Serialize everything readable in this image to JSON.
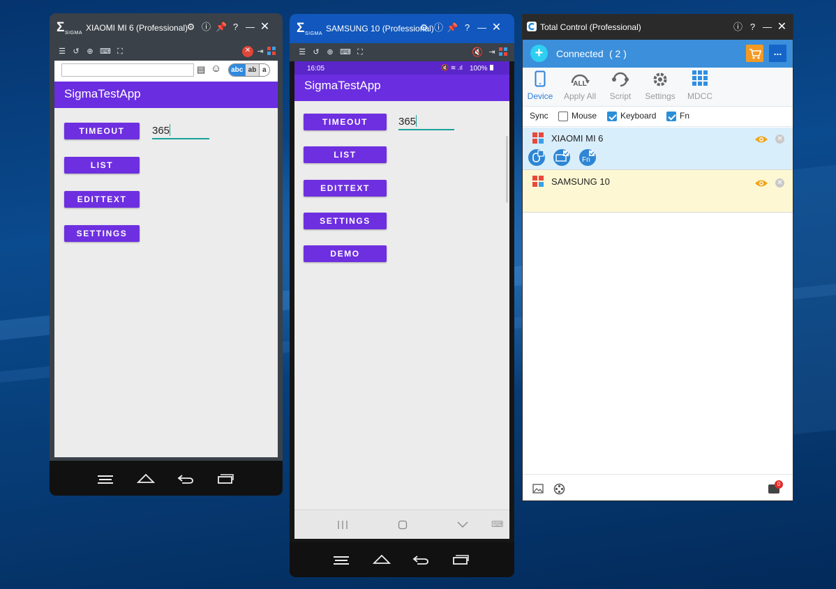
{
  "windows": {
    "xiaomi": {
      "title": "XIAOMI MI 6 (Professional)",
      "logo_text": "SIGMA",
      "app_title": "SigmaTestApp",
      "ime_buttons": [
        "abc",
        "ab",
        "a"
      ],
      "buttons": [
        "TIMEOUT",
        "LIST",
        "EDITTEXT",
        "SETTINGS"
      ],
      "field_value": "365"
    },
    "samsung": {
      "title": "SAMSUNG 10 (Professional)",
      "logo_text": "SIGMA",
      "status_time": "16:05",
      "status_battery": "100%",
      "app_title": "SigmaTestApp",
      "buttons": [
        "TIMEOUT",
        "LIST",
        "EDITTEXT",
        "SETTINGS",
        "DEMO"
      ],
      "field_value": "365"
    }
  },
  "total_control": {
    "title": "Total Control (Professional)",
    "connected_label": "Connected",
    "connected_count": "( 2 )",
    "more_label": "...",
    "tabs": [
      "Device",
      "Apply All",
      "Script",
      "Settings",
      "MDCC"
    ],
    "apply_all_badge": "ALL",
    "sync": {
      "label": "Sync",
      "mouse": "Mouse",
      "keyboard": "Keyboard",
      "fn": "Fn"
    },
    "sync_state": {
      "mouse": false,
      "keyboard": true,
      "fn": true
    },
    "devices": [
      {
        "name": "XIAOMI MI 6"
      },
      {
        "name": "SAMSUNG 10"
      }
    ],
    "notification_count": "0"
  },
  "colors": {
    "app_bar": "#6a2de0",
    "button": "#6e2fe0",
    "accent_teal": "#1aa19b",
    "tc_blue": "#3b8fdb",
    "selected_row": "#d9eefb",
    "idle_row": "#fdf8d3",
    "eye": "#f0a61c"
  }
}
